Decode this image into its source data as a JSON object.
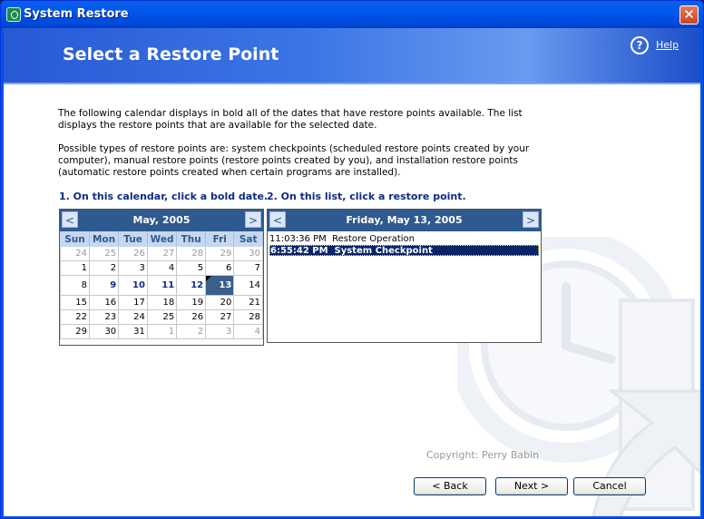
{
  "window": {
    "title": "System Restore",
    "close_glyph": "✕"
  },
  "header": {
    "title": "Select a Restore Point",
    "help_icon_glyph": "?",
    "help_label": "Help",
    "colors": {
      "accent": "#2859d6",
      "calendar_header": "#2f5a8f",
      "selection": "#0a246a"
    }
  },
  "description": {
    "paragraph1": "The following calendar displays in bold all of the dates that have restore points available. The list displays the restore points that are available for the selected date.",
    "paragraph2": "Possible types of restore points are: system checkpoints (scheduled restore points created by your computer), manual restore points (restore points created by you), and installation restore points (automatic restore points created when certain programs are installed)."
  },
  "steps": {
    "step1": "1. On this calendar, click a bold date.",
    "step2": "2. On this list, click a restore point."
  },
  "calendar": {
    "prev_label": "<",
    "next_label": ">",
    "month_title": "May, 2005",
    "weekdays": [
      "Sun",
      "Mon",
      "Tue",
      "Wed",
      "Thu",
      "Fri",
      "Sat"
    ],
    "weeks": [
      [
        "24",
        "25",
        "26",
        "27",
        "28",
        "29",
        "30"
      ],
      [
        "1",
        "2",
        "3",
        "4",
        "5",
        "6",
        "7"
      ],
      [
        "8",
        "9",
        "10",
        "11",
        "12",
        "13",
        "14"
      ],
      [
        "15",
        "16",
        "17",
        "18",
        "19",
        "20",
        "21"
      ],
      [
        "22",
        "23",
        "24",
        "25",
        "26",
        "27",
        "28"
      ],
      [
        "29",
        "30",
        "31",
        "1",
        "2",
        "3",
        "4"
      ]
    ],
    "bold_dates": [
      "9",
      "10",
      "11",
      "12",
      "13"
    ],
    "selected_date": "13"
  },
  "restore_list": {
    "prev_label": "<",
    "next_label": ">",
    "date_title": "Friday, May 13, 2005",
    "items": [
      {
        "time": "11:03:36 PM",
        "description": "Restore Operation"
      },
      {
        "time": "6:55:42 PM",
        "description": "System Checkpoint"
      }
    ],
    "selected_index": 1
  },
  "copyright": "Copyright: Perry Babin",
  "buttons": {
    "back": "< Back",
    "next": "Next >",
    "cancel": "Cancel"
  }
}
